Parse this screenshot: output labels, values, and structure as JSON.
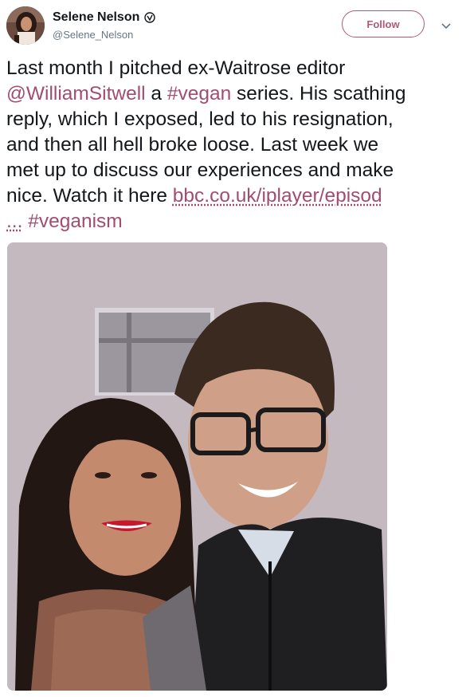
{
  "tweet": {
    "author": {
      "display_name": "Selene Nelson",
      "handle": "@Selene_Nelson",
      "verified": true
    },
    "follow_label": "Follow",
    "lines": {
      "l1": "Last month I pitched ex-Waitrose editor",
      "l2_mention": "@WilliamSitwell",
      "l2_a": " a ",
      "l2_hashtag": "#vegan",
      "l2_b": " series. His scathing",
      "l3": "reply, which I exposed, led to his resignation,",
      "l4": "and then all hell broke loose. Last week we",
      "l5": "met up to discuss our experiences and make",
      "l6_a": "nice. Watch it here ",
      "l6_link": "bbc.co.uk/iplayer/episod",
      "l7_link": "...",
      "l7_gap": " ",
      "l7_hashtag": "#veganism"
    },
    "colors": {
      "accent": "#a24d6f",
      "text": "#14171a",
      "muted": "#657786"
    },
    "icons": {
      "verified": "verified-badge-icon",
      "caret": "chevron-down-icon"
    }
  }
}
